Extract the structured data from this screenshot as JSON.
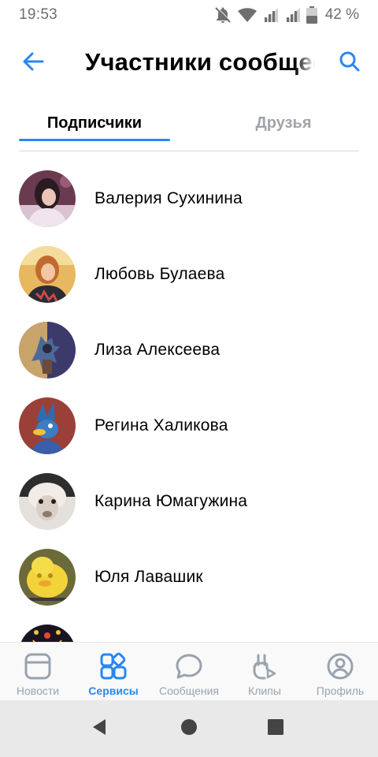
{
  "status_bar": {
    "time": "19:53",
    "battery": "42 %",
    "icons": [
      "notifications-off-icon",
      "wifi-icon",
      "signal-icon",
      "signal-icon",
      "battery-icon"
    ]
  },
  "header": {
    "title": "Участники сообщества",
    "back_icon": "arrow-left-icon",
    "search_icon": "search-icon"
  },
  "tabs": [
    {
      "label": "Подписчики",
      "active": true
    },
    {
      "label": "Друзья",
      "active": false
    }
  ],
  "members": [
    {
      "name": "Валерия Сухинина"
    },
    {
      "name": "Любовь Булаева"
    },
    {
      "name": "Лиза Алексеева"
    },
    {
      "name": "Регина Халикова"
    },
    {
      "name": "Карина Юмагужина"
    },
    {
      "name": "Юля Лавашик"
    }
  ],
  "bottom_nav": [
    {
      "label": "Новости",
      "icon": "news-icon",
      "active": false
    },
    {
      "label": "Сервисы",
      "icon": "services-icon",
      "active": true
    },
    {
      "label": "Сообщения",
      "icon": "messages-icon",
      "active": false
    },
    {
      "label": "Клипы",
      "icon": "clips-icon",
      "active": false
    },
    {
      "label": "Профиль",
      "icon": "profile-icon",
      "active": false
    }
  ],
  "colors": {
    "accent": "#2787f5",
    "inactive_tab": "#a1a4a8",
    "nav_inactive": "#99a2ad"
  }
}
